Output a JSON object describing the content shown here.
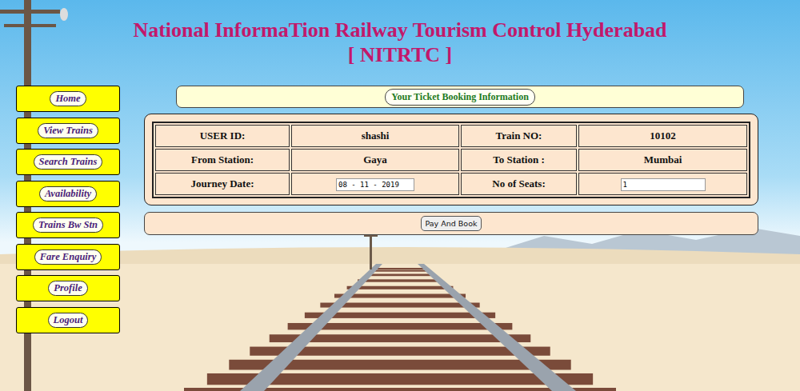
{
  "header": {
    "title": "National InformaTion Railway Tourism Control Hyderabad",
    "subtitle": "[ NITRTC ]"
  },
  "sidebar": {
    "items": [
      {
        "label": "Home"
      },
      {
        "label": "View Trains"
      },
      {
        "label": "Search Trains"
      },
      {
        "label": "Availability"
      },
      {
        "label": "Trains Bw Stn"
      },
      {
        "label": "Fare Enquiry"
      },
      {
        "label": "Profile"
      },
      {
        "label": "Logout"
      }
    ]
  },
  "panel": {
    "title": "Your Ticket Booking Information"
  },
  "table": {
    "rows": [
      [
        {
          "label": "USER ID:",
          "value": "shashi",
          "kind": "text"
        },
        {
          "label": "Train NO:",
          "value": "10102",
          "kind": "text"
        }
      ],
      [
        {
          "label": "From Station:",
          "value": "Gaya",
          "kind": "text"
        },
        {
          "label": "To Station :",
          "value": "Mumbai",
          "kind": "text"
        }
      ],
      [
        {
          "label": "Journey Date:",
          "value": "08 - 11 - 2019",
          "kind": "input"
        },
        {
          "label": "No of Seats:",
          "value": "1",
          "kind": "input"
        }
      ]
    ]
  },
  "button": {
    "label": "Pay And Book"
  }
}
